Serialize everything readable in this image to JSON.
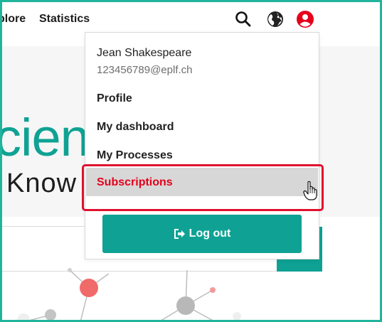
{
  "nav": {
    "explore_label": "plore",
    "statistics_label": "Statistics",
    "icons": [
      "search-icon",
      "globe-icon",
      "user-icon"
    ],
    "accent": "#e4001b"
  },
  "hero": {
    "title_fragment": "cien",
    "subtitle_fragment": "Know"
  },
  "user_menu": {
    "name": "Jean Shakespeare",
    "email": "123456789@eplf.ch",
    "items": [
      {
        "label": "Profile"
      },
      {
        "label": "My dashboard"
      },
      {
        "label": "My Processes"
      },
      {
        "label": "Subscriptions",
        "highlighted": true
      }
    ],
    "logout_label": "Log out",
    "logout_icon": "logout-icon"
  },
  "colors": {
    "brand_teal": "#0fa294",
    "frame": "#20b49c",
    "highlight": "#e0102e",
    "hover_bg": "#d7d7d7"
  }
}
